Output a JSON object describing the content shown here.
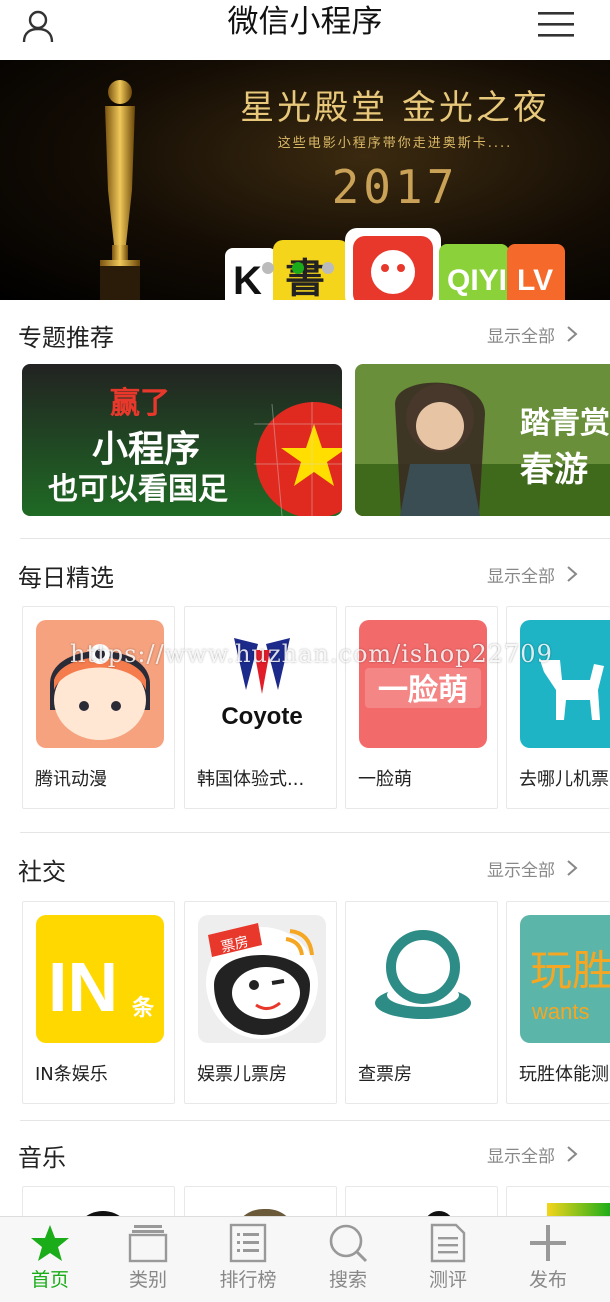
{
  "header": {
    "title": "微信小程序",
    "user_icon": "user-icon",
    "menu_icon": "hamburger-menu-icon"
  },
  "banner": {
    "headline": "星光殿堂 金光之夜",
    "subline": "这些电影小程序带你走进奥斯卡....",
    "year": "2017",
    "active_dot": 1,
    "dot_count": 3
  },
  "sections": [
    {
      "title": "专题推荐",
      "show_all": "显示全部",
      "features": [
        {
          "line1": "赢了",
          "line2": "小程序",
          "line3": "也可以看国足"
        },
        {
          "line1": "踏青赏",
          "line2": "春游"
        }
      ]
    },
    {
      "title": "每日精选",
      "show_all": "显示全部",
      "apps": [
        {
          "name": "腾讯动漫"
        },
        {
          "name": "韩国体验式...",
          "logo_text": "Coyote"
        },
        {
          "name": "一脸萌",
          "logo_text": "一脸萌"
        },
        {
          "name": "去哪儿机票"
        }
      ]
    },
    {
      "title": "社交",
      "show_all": "显示全部",
      "apps": [
        {
          "name": "IN条娱乐",
          "logo_text": "IN",
          "logo_sub": "条"
        },
        {
          "name": "娱票儿票房",
          "logo_text": "票房"
        },
        {
          "name": "查票房"
        },
        {
          "name": "玩胜体能测",
          "logo_text": "玩胜",
          "logo_sub": "wants"
        }
      ]
    },
    {
      "title": "音乐",
      "show_all": "显示全部"
    }
  ],
  "watermark": "https://www.huzhan.com/ishop22709",
  "tabbar": [
    {
      "label": "首页",
      "icon": "star-icon",
      "active": true
    },
    {
      "label": "类别",
      "icon": "category-stack-icon",
      "active": false
    },
    {
      "label": "排行榜",
      "icon": "ranking-list-icon",
      "active": false
    },
    {
      "label": "搜索",
      "icon": "search-icon",
      "active": false
    },
    {
      "label": "测评",
      "icon": "review-document-icon",
      "active": false
    },
    {
      "label": "发布",
      "icon": "plus-icon",
      "active": false
    }
  ],
  "colors": {
    "accent_green": "#1aad19",
    "muted_gray": "#888888"
  }
}
